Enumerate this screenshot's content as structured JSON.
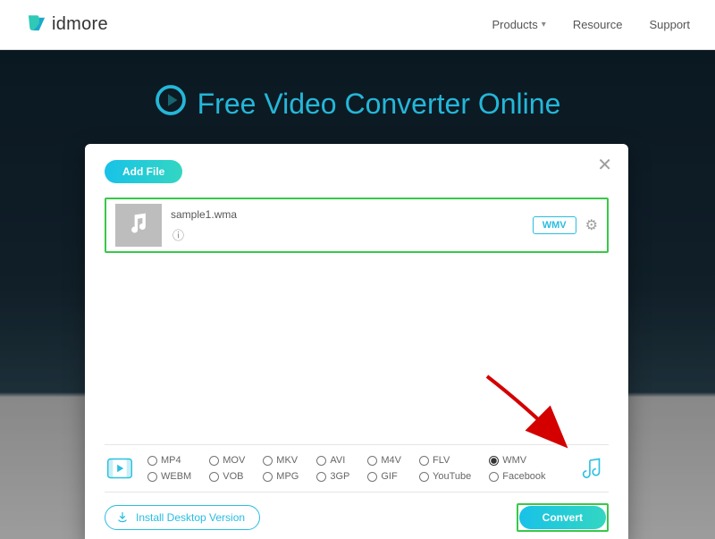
{
  "brand": {
    "name": "idmore"
  },
  "nav": {
    "products": "Products",
    "resource": "Resource",
    "support": "Support"
  },
  "hero": {
    "title": "Free Video Converter Online"
  },
  "modal": {
    "add_file": "Add File",
    "file": {
      "name": "sample1.wma",
      "badge": "WMV"
    },
    "formats": {
      "row1": [
        "MP4",
        "MOV",
        "MKV",
        "AVI",
        "M4V",
        "FLV",
        "WMV"
      ],
      "row2": [
        "WEBM",
        "VOB",
        "MPG",
        "3GP",
        "GIF",
        "YouTube",
        "Facebook"
      ],
      "selected": "WMV"
    },
    "install": "Install Desktop Version",
    "convert": "Convert"
  }
}
